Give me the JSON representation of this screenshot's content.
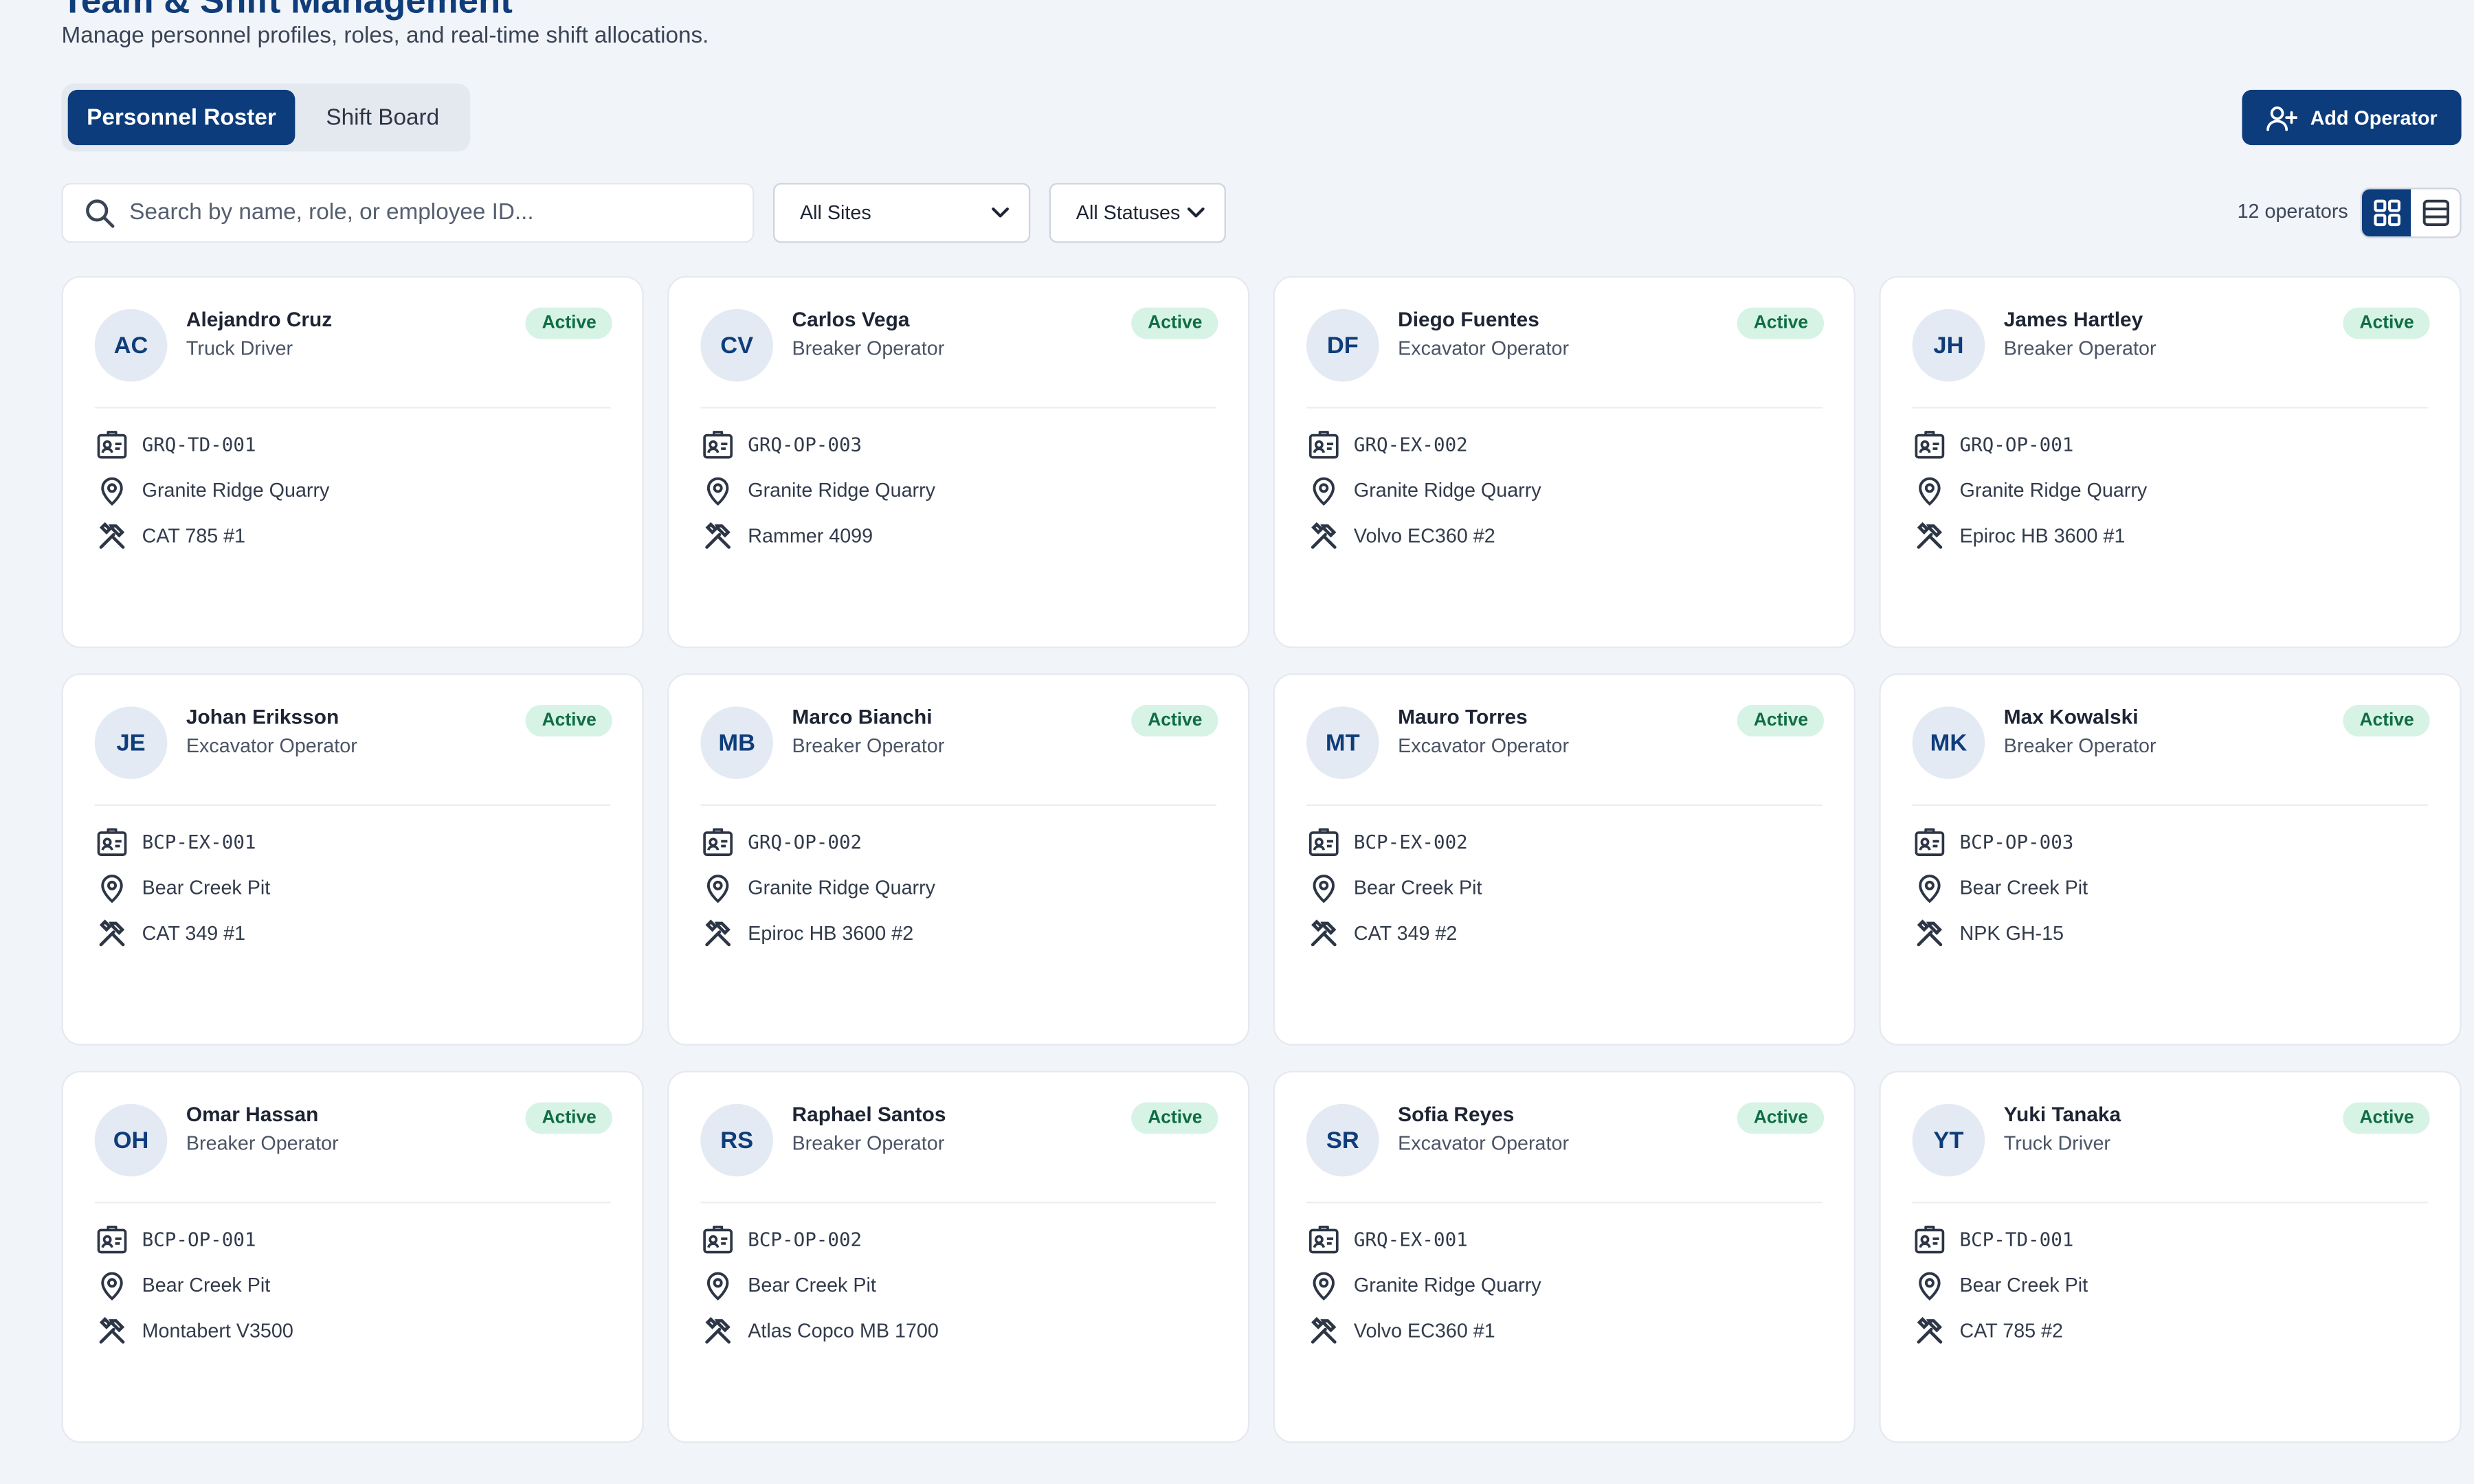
{
  "header": {
    "title": "Team & Shift Management",
    "subtitle": "Manage personnel profiles, roles, and real-time shift allocations."
  },
  "tabs": [
    {
      "label": "Personnel Roster",
      "active": true
    },
    {
      "label": "Shift Board",
      "active": false
    }
  ],
  "actions": {
    "add_operator_label": "Add Operator"
  },
  "filters": {
    "search_placeholder": "Search by name, role, or employee ID...",
    "site_selected": "All Sites",
    "status_selected": "All Statuses"
  },
  "summary": {
    "count_text": "12 operators"
  },
  "view_toggle": {
    "selected": "grid-view",
    "options": [
      "grid-view-icon",
      "list-view-icon"
    ]
  },
  "colors": {
    "primary": "#0c3c7c",
    "status_active_bg": "#d7f3e5",
    "status_active_text": "#0f6d45",
    "page_bg": "#f1f4f9"
  },
  "icons": {
    "id": "id-card-icon",
    "site": "map-pin-icon",
    "equipment": "tools-icon"
  },
  "operators": [
    {
      "initials": "AC",
      "name": "Alejandro Cruz",
      "role": "Truck Driver",
      "status": "Active",
      "employee_id": "GRQ-TD-001",
      "site": "Granite Ridge Quarry",
      "equipment": "CAT 785 #1"
    },
    {
      "initials": "CV",
      "name": "Carlos Vega",
      "role": "Breaker Operator",
      "status": "Active",
      "employee_id": "GRQ-OP-003",
      "site": "Granite Ridge Quarry",
      "equipment": "Rammer 4099"
    },
    {
      "initials": "DF",
      "name": "Diego Fuentes",
      "role": "Excavator Operator",
      "status": "Active",
      "employee_id": "GRQ-EX-002",
      "site": "Granite Ridge Quarry",
      "equipment": "Volvo EC360 #2"
    },
    {
      "initials": "JH",
      "name": "James Hartley",
      "role": "Breaker Operator",
      "status": "Active",
      "employee_id": "GRQ-OP-001",
      "site": "Granite Ridge Quarry",
      "equipment": "Epiroc HB 3600 #1"
    },
    {
      "initials": "JE",
      "name": "Johan Eriksson",
      "role": "Excavator Operator",
      "status": "Active",
      "employee_id": "BCP-EX-001",
      "site": "Bear Creek Pit",
      "equipment": "CAT 349 #1"
    },
    {
      "initials": "MB",
      "name": "Marco Bianchi",
      "role": "Breaker Operator",
      "status": "Active",
      "employee_id": "GRQ-OP-002",
      "site": "Granite Ridge Quarry",
      "equipment": "Epiroc HB 3600 #2"
    },
    {
      "initials": "MT",
      "name": "Mauro Torres",
      "role": "Excavator Operator",
      "status": "Active",
      "employee_id": "BCP-EX-002",
      "site": "Bear Creek Pit",
      "equipment": "CAT 349 #2"
    },
    {
      "initials": "MK",
      "name": "Max Kowalski",
      "role": "Breaker Operator",
      "status": "Active",
      "employee_id": "BCP-OP-003",
      "site": "Bear Creek Pit",
      "equipment": "NPK GH-15"
    },
    {
      "initials": "OH",
      "name": "Omar Hassan",
      "role": "Breaker Operator",
      "status": "Active",
      "employee_id": "BCP-OP-001",
      "site": "Bear Creek Pit",
      "equipment": "Montabert V3500"
    },
    {
      "initials": "RS",
      "name": "Raphael Santos",
      "role": "Breaker Operator",
      "status": "Active",
      "employee_id": "BCP-OP-002",
      "site": "Bear Creek Pit",
      "equipment": "Atlas Copco MB 1700"
    },
    {
      "initials": "SR",
      "name": "Sofia Reyes",
      "role": "Excavator Operator",
      "status": "Active",
      "employee_id": "GRQ-EX-001",
      "site": "Granite Ridge Quarry",
      "equipment": "Volvo EC360 #1"
    },
    {
      "initials": "YT",
      "name": "Yuki Tanaka",
      "role": "Truck Driver",
      "status": "Active",
      "employee_id": "BCP-TD-001",
      "site": "Bear Creek Pit",
      "equipment": "CAT 785 #2"
    }
  ]
}
